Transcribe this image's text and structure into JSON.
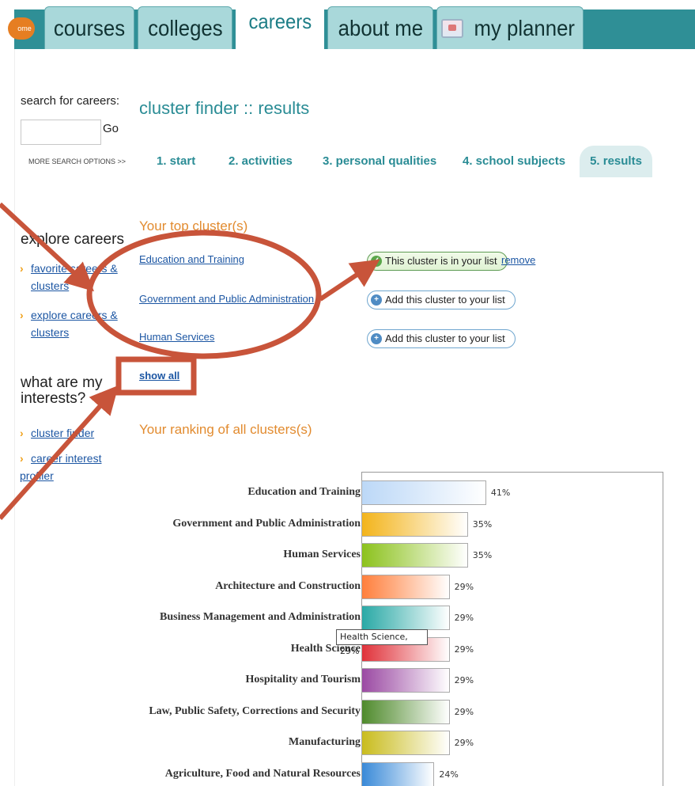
{
  "nav": {
    "home_label": "ome",
    "tabs": [
      {
        "label": "courses"
      },
      {
        "label": "colleges"
      },
      {
        "label": "careers"
      },
      {
        "label": "about me"
      },
      {
        "label": "my planner"
      }
    ],
    "active_tab": "careers"
  },
  "sidebar": {
    "search_label": "search for careers:",
    "search_value": "",
    "go_label": "Go",
    "more_search": "MORE SEARCH OPTIONS >>",
    "explore_head": "explore careers",
    "explore_links": [
      {
        "line1": "favorite careers &",
        "line2": "clusters"
      },
      {
        "line1": "explore careers &",
        "line2": "clusters"
      }
    ],
    "interests_head_1": "what are my",
    "interests_head_2": "interests?",
    "interest_links": [
      "cluster finder",
      "career interest profiler"
    ]
  },
  "main": {
    "title": "cluster finder :: results",
    "steps": [
      "1. start",
      "2. activities",
      "3. personal qualities",
      "4. school subjects",
      "5. results"
    ],
    "active_step": "5. results",
    "top_clusters_head": "Your top cluster(s)",
    "top_clusters": [
      {
        "name": "Education and Training",
        "action": "This cluster is in your list",
        "in_list": true,
        "remove": "remove"
      },
      {
        "name": "Government and Public Administration",
        "action": "Add this cluster to your list",
        "in_list": false
      },
      {
        "name": "Human Services",
        "action": "Add this cluster to your list",
        "in_list": false
      }
    ],
    "show_all": "show all",
    "ranking_head": "Your ranking of all clusters(s)"
  },
  "chart_data": {
    "type": "bar",
    "orientation": "horizontal",
    "categories": [
      "Education and Training",
      "Government and Public Administration",
      "Human Services",
      "Architecture and Construction",
      "Business Management and Administration",
      "Health Science",
      "Hospitality and Tourism",
      "Law, Public Safety, Corrections and Security",
      "Manufacturing",
      "Agriculture, Food and Natural Resources"
    ],
    "values": [
      41,
      35,
      35,
      29,
      29,
      29,
      29,
      29,
      29,
      24
    ],
    "value_labels": [
      "41%",
      "35%",
      "35%",
      "29%",
      "29%",
      "29%",
      "29%",
      "29%",
      "29%",
      "24%"
    ],
    "colors": [
      "#bcd8f7",
      "#f3b41b",
      "#8cc21d",
      "#ff7f3c",
      "#2aa9a6",
      "#e0323a",
      "#9b4aa3",
      "#4f8a2c",
      "#c9bc1e",
      "#3a8ad8"
    ],
    "tooltip": "Health Science, 29%"
  },
  "annotation": {
    "color": "#c8543a"
  }
}
